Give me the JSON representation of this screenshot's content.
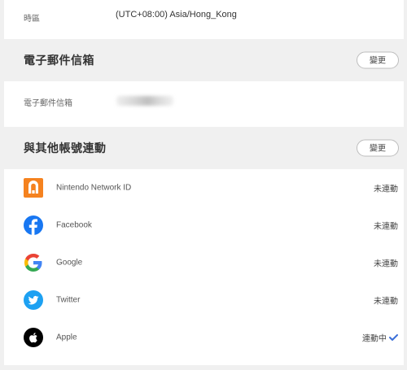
{
  "timezone": {
    "label": "時區",
    "value": "(UTC+08:00) Asia/Hong_Kong"
  },
  "email_section": {
    "title": "電子郵件信箱",
    "change_label": "變更",
    "field_label": "電子郵件信箱"
  },
  "links_section": {
    "title": "與其他帳號連動",
    "change_label": "變更",
    "items": [
      {
        "name": "Nintendo Network ID",
        "status": "未連動",
        "icon": "nintendo-network-icon"
      },
      {
        "name": "Facebook",
        "status": "未連動",
        "icon": "facebook-icon"
      },
      {
        "name": "Google",
        "status": "未連動",
        "icon": "google-icon"
      },
      {
        "name": "Twitter",
        "status": "未連動",
        "icon": "twitter-icon"
      },
      {
        "name": "Apple",
        "status": "連動中",
        "icon": "apple-icon"
      }
    ]
  },
  "colors": {
    "nintendo": "#f5821f",
    "facebook": "#1877f2",
    "twitter": "#1da1f2",
    "apple": "#000000",
    "check": "#3b6fd8"
  }
}
